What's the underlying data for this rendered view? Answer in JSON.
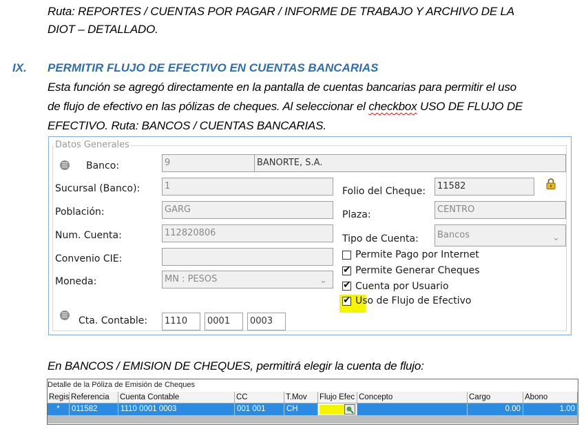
{
  "doc": {
    "ruta_line1": "Ruta: REPORTES / CUENTAS POR PAGAR / INFORME DE TRABAJO Y ARCHIVO DE LA",
    "ruta_line2": "DIOT – DETALLADO.",
    "section_num": "IX.",
    "section_title": "PERMITIR FLUJO DE EFECTIVO EN CUENTAS BANCARIAS",
    "para_line1": "Esta función se agregó directamente en la pantalla de cuentas bancarias para permitir el uso",
    "para_line2_a": "de flujo de efectivo en las pólizas de cheques. Al seleccionar el ",
    "para_line2_b": "checkbox",
    "para_line2_c": " USO DE FLUJO DE",
    "para_line3": "EFECTIVO. Ruta: BANCOS / CUENTAS BANCARIAS.",
    "para2": "En BANCOS / EMISION DE CHEQUES, permitirá elegir la cuenta de flujo:"
  },
  "dialog": {
    "group_title": "Datos Generales",
    "banco_label": "Banco:",
    "banco_code": "9",
    "banco_name": "BANORTE, S.A.",
    "sucursal_label": "Sucursal (Banco):",
    "sucursal_value": "1",
    "poblacion_label": "Población:",
    "poblacion_value": "GARG",
    "num_cuenta_label": "Num. Cuenta:",
    "num_cuenta_value": "112820806",
    "convenio_label": "Convenio CIE:",
    "convenio_value": "",
    "moneda_label": "Moneda:",
    "moneda_value": "MN : PESOS",
    "cta_contable_label": "Cta. Contable:",
    "cta_contable_1": "1110",
    "cta_contable_2": "0001",
    "cta_contable_3": "0003",
    "folio_label": "Folio del Cheque:",
    "folio_value": "11582",
    "plaza_label": "Plaza:",
    "plaza_value": "CENTRO",
    "tipo_label": "Tipo de Cuenta:",
    "tipo_value": "Bancos",
    "checkboxes": [
      {
        "label": "Permite Pago por Internet",
        "checked": false
      },
      {
        "label": "Permite Generar Cheques",
        "checked": true
      },
      {
        "label": "Cuenta por Usuario",
        "checked": true
      },
      {
        "label": "Uso de Flujo de Efectivo",
        "checked": true
      }
    ],
    "highlight_color": "#f5f500"
  },
  "grid": {
    "title": "Detalle de la Póliza de Emisión de Cheques",
    "columns": [
      "Regis",
      "Referencia",
      "Cuenta Contable",
      "CC",
      "T.Mov",
      "Flujo Efec",
      "Concepto",
      "Cargo",
      "Abono"
    ],
    "row": {
      "regis": "*",
      "referencia": "011582",
      "cuenta_contable": "1110 0001 0003",
      "cc": "001 001",
      "tmov": "CH",
      "flujo": "",
      "concepto": "",
      "cargo": "0.00",
      "abono": "1.00"
    },
    "selection_color": "#2a8be0"
  }
}
